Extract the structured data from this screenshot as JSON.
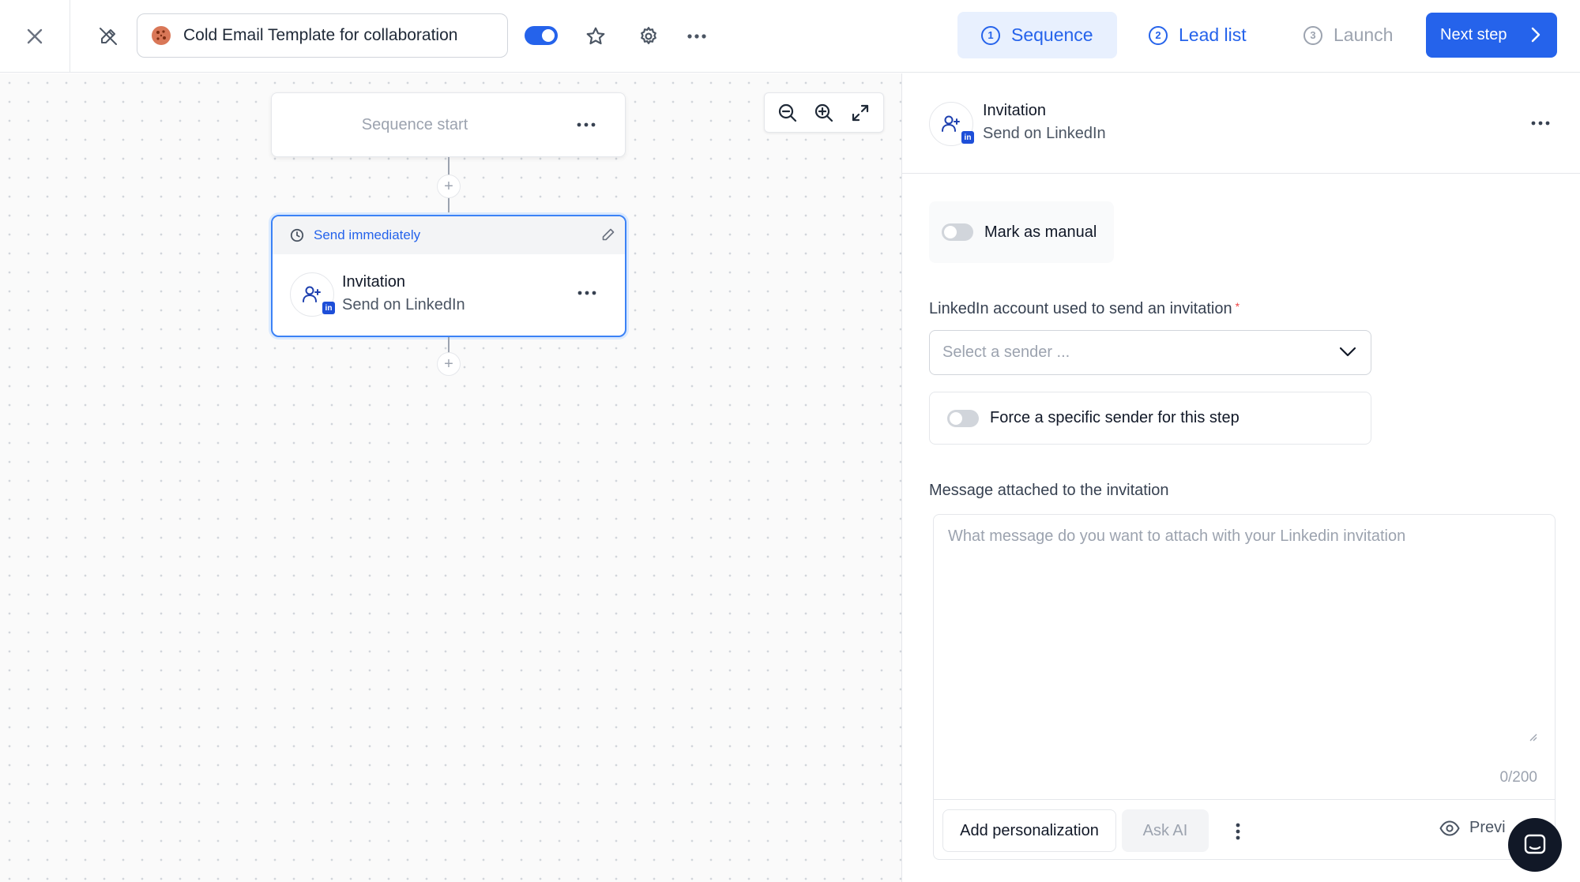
{
  "header": {
    "campaign_name": "Cold Email Template for collaboration",
    "active": true,
    "steps": [
      {
        "number": "1",
        "label": "Sequence",
        "state": "active"
      },
      {
        "number": "2",
        "label": "Lead list",
        "state": "available"
      },
      {
        "number": "3",
        "label": "Launch",
        "state": "disabled"
      }
    ],
    "next_label": "Next step"
  },
  "canvas": {
    "start_node_label": "Sequence start",
    "step": {
      "delay_label": "Send immediately",
      "title": "Invitation",
      "subtitle": "Send on LinkedIn"
    }
  },
  "panel": {
    "title": "Invitation",
    "subtitle": "Send on LinkedIn",
    "mark_manual_label": "Mark as manual",
    "mark_manual_on": false,
    "account_label": "LinkedIn account used to send an invitation",
    "required_mark": "*",
    "sender_placeholder": "Select a sender ...",
    "force_sender_label": "Force a specific sender for this step",
    "force_sender_on": false,
    "message_label": "Message attached to the invitation",
    "message_placeholder": "What message do you want to attach with your Linkedin invitation",
    "message_value": "",
    "counter": "0/200",
    "add_personalization_label": "Add personalization",
    "ask_ai_label": "Ask AI",
    "preview_label": "Previ"
  },
  "colors": {
    "accent": "#2563eb",
    "accent_soft": "#e8f0fe",
    "linkedin": "#1d4ed8",
    "required": "#ef4444"
  },
  "icons": {
    "close": "close-icon",
    "pencil_off": "pencil-off-icon",
    "star": "star-icon",
    "gear": "gear-icon",
    "more": "more-horizontal-icon",
    "chevron_right": "chevron-right-icon",
    "zoom_out": "zoom-out-icon",
    "zoom_in": "zoom-in-icon",
    "expand": "expand-icon",
    "clock": "clock-icon",
    "add_user": "add-user-icon",
    "linkedin": "linkedin-icon",
    "eye": "eye-icon",
    "chat": "chat-icon"
  }
}
